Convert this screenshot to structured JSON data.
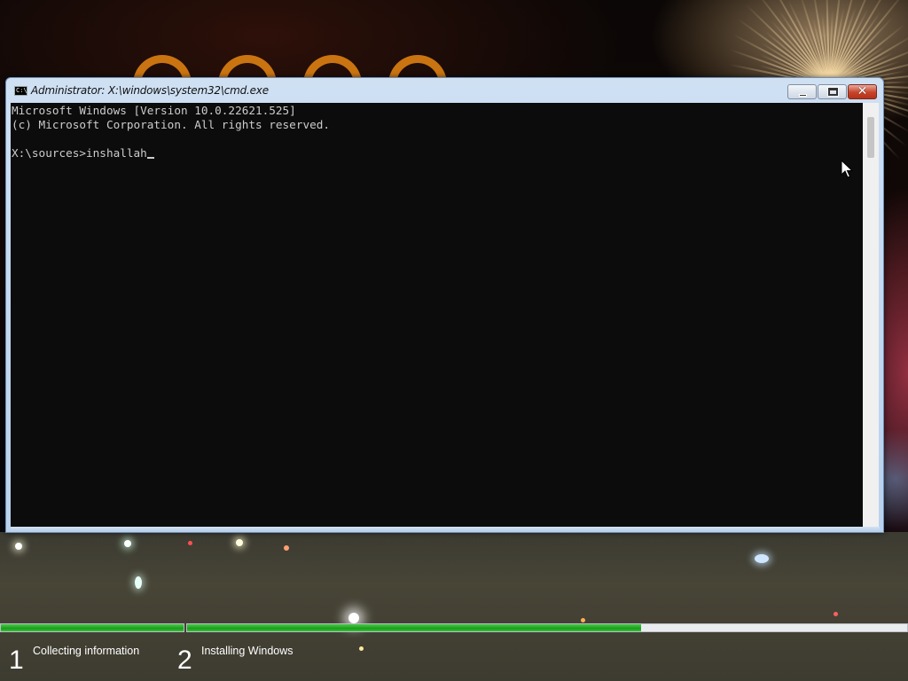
{
  "window": {
    "title": "Administrator: X:\\windows\\system32\\cmd.exe",
    "icon": "cmd-icon",
    "icon_glyph": "C:\\",
    "controls": {
      "minimize": "minimize-icon",
      "maximize": "maximize-icon",
      "close": "close-icon",
      "close_glyph": "✕"
    }
  },
  "console": {
    "lines": [
      "Microsoft Windows [Version 10.0.22621.525]",
      "(c) Microsoft Corporation. All rights reserved.",
      "",
      "X:\\sources>inshallah"
    ],
    "colors": {
      "background": "#0c0c0c",
      "text": "#cccccc"
    }
  },
  "setup": {
    "steps": [
      {
        "number": "1",
        "label": "Collecting information",
        "progress": 1.0
      },
      {
        "number": "2",
        "label": "Installing Windows",
        "progress": 0.63
      }
    ],
    "colors": {
      "progress": "#17a017",
      "track": "#e9ecef"
    }
  }
}
